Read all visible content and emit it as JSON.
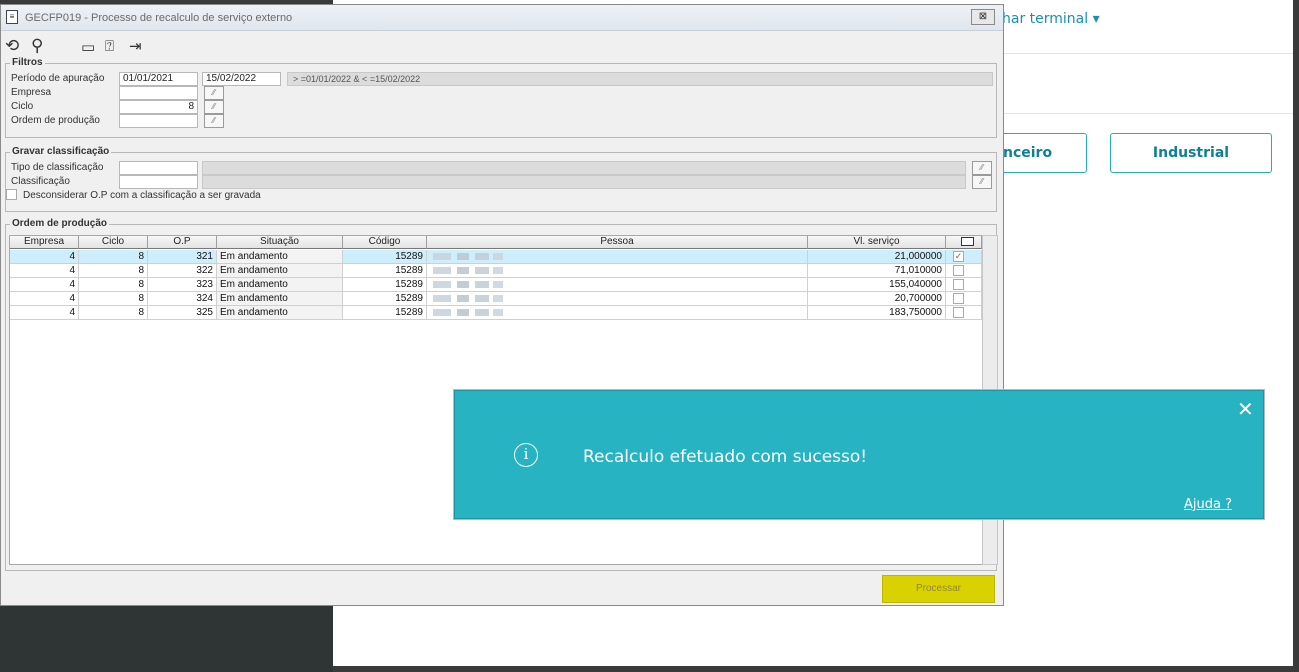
{
  "background": {
    "terminal_link": "har terminal ▾",
    "tiles": {
      "financeiro": "nceiro",
      "industrial": "Industrial"
    }
  },
  "window": {
    "title": "GECFP019 - Processo de recalculo de serviço externo",
    "close_label": "⊠",
    "toolbar": [
      "refresh-icon",
      "search-icon",
      "calendar-icon",
      "help-icon",
      "exit-icon"
    ]
  },
  "filtros": {
    "title": "Filtros",
    "periodo_label": "Período de apuração",
    "periodo_inicio": "01/01/2021",
    "periodo_fim": "15/02/2022",
    "periodo_expr": "> =01/01/2022 & < =15/02/2022",
    "empresa_label": "Empresa",
    "empresa_value": "",
    "ciclo_label": "Ciclo",
    "ciclo_value": "8",
    "ordem_label": "Ordem de produção",
    "ordem_value": ""
  },
  "gravar": {
    "title": "Gravar classificação",
    "tipo_label": "Tipo de classificação",
    "classificacao_label": "Classificação",
    "desconsiderar_label": "Desconsiderar O.P com a classificação a ser gravada"
  },
  "ordem": {
    "title": "Ordem de produção",
    "columns": [
      "Empresa",
      "Ciclo",
      "O.P",
      "Situação",
      "Código",
      "Pessoa",
      "Vl. serviço"
    ],
    "rows": [
      {
        "empresa": "4",
        "ciclo": "8",
        "op": "321",
        "situacao": "Em andamento",
        "codigo": "15289",
        "valor": "21,000000",
        "checked": true
      },
      {
        "empresa": "4",
        "ciclo": "8",
        "op": "322",
        "situacao": "Em andamento",
        "codigo": "15289",
        "valor": "71,010000",
        "checked": false
      },
      {
        "empresa": "4",
        "ciclo": "8",
        "op": "323",
        "situacao": "Em andamento",
        "codigo": "15289",
        "valor": "155,040000",
        "checked": false
      },
      {
        "empresa": "4",
        "ciclo": "8",
        "op": "324",
        "situacao": "Em andamento",
        "codigo": "15289",
        "valor": "20,700000",
        "checked": false
      },
      {
        "empresa": "4",
        "ciclo": "8",
        "op": "325",
        "situacao": "Em andamento",
        "codigo": "15289",
        "valor": "183,750000",
        "checked": false
      }
    ]
  },
  "actions": {
    "processar": "Processar"
  },
  "toast": {
    "message": "Recalculo efetuado com sucesso!",
    "help": "Ajuda ?",
    "close": "✕",
    "icon": "i",
    "color": "#28b3c2"
  }
}
